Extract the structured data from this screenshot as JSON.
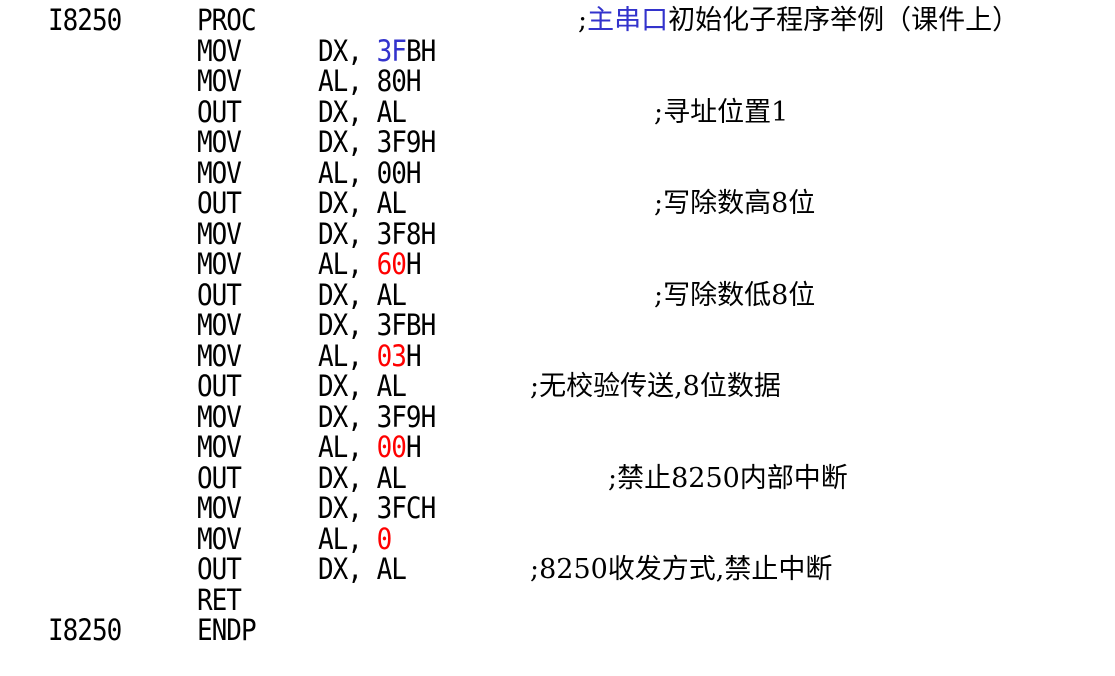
{
  "colors": {
    "text": "#000000",
    "red": "#ff0000",
    "blue": "#3333cc"
  },
  "lines": [
    {
      "label": "I8250",
      "op": "PROC",
      "comment_prefix": ";",
      "comment_highlight": "主串口",
      "comment_rest": "初始化子程序举例（课件上）"
    },
    {
      "op": "MOV",
      "arg_pre": "DX, ",
      "arg_hl": "3F",
      "arg_post": "BH"
    },
    {
      "op": "MOV",
      "arg": "AL, 80H"
    },
    {
      "op": "OUT",
      "arg": "DX, AL",
      "comment": ";寻址位置1"
    },
    {
      "op": "MOV",
      "arg": "DX, 3F9H"
    },
    {
      "op": "MOV",
      "arg": "AL, 00H"
    },
    {
      "op": "OUT",
      "arg": "DX, AL",
      "comment": ";写除数高8位"
    },
    {
      "op": "MOV",
      "arg": "DX, 3F8H"
    },
    {
      "op": "MOV",
      "arg_pre": "AL, ",
      "arg_hl": "60",
      "arg_post": "H"
    },
    {
      "op": "OUT",
      "arg": "DX, AL",
      "comment": ";写除数低8位"
    },
    {
      "op": "MOV",
      "arg": "DX, 3FBH"
    },
    {
      "op": "MOV",
      "arg_pre": "AL, ",
      "arg_hl": "03",
      "arg_post": "H"
    },
    {
      "op": "OUT",
      "arg": "DX, AL",
      "comment": ";无校验传送,8位数据"
    },
    {
      "op": "MOV",
      "arg": "DX, 3F9H"
    },
    {
      "op": "MOV",
      "arg_pre": "AL, ",
      "arg_hl": "00",
      "arg_post": "H"
    },
    {
      "op": "OUT",
      "arg": "DX, AL",
      "comment": ";禁止8250内部中断"
    },
    {
      "op": "MOV",
      "arg": "DX, 3FCH"
    },
    {
      "op": "MOV",
      "arg_pre": "AL, ",
      "arg_hl": "0",
      "arg_post": ""
    },
    {
      "op": "OUT",
      "arg": "DX, AL",
      "comment": ";8250收发方式,禁止中断"
    },
    {
      "op": "RET"
    },
    {
      "label": "I8250",
      "op": "ENDP"
    }
  ]
}
